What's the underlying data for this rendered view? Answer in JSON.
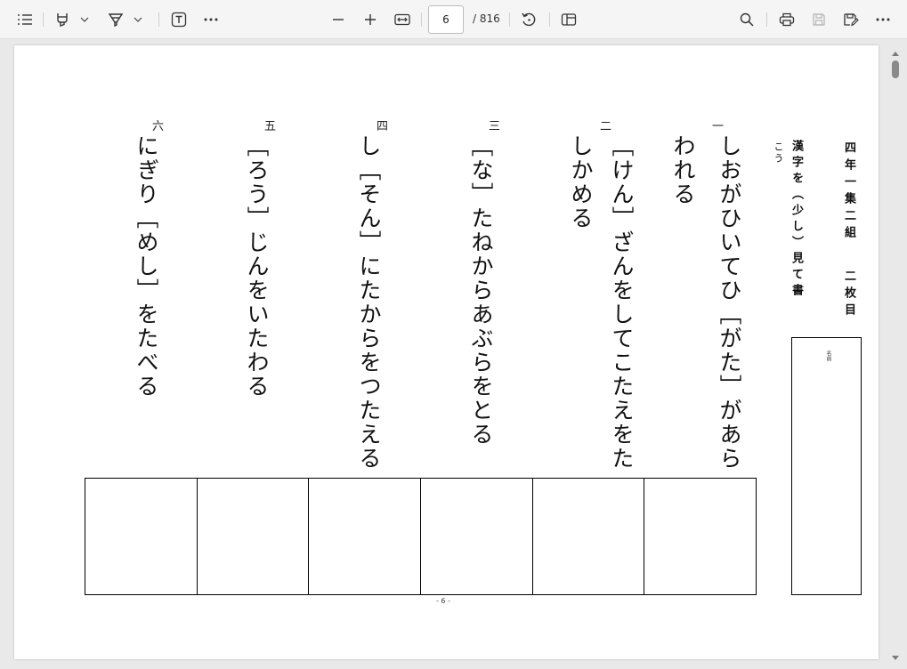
{
  "toolbar": {
    "page_number": "6",
    "page_total": "/ 816",
    "icons": [
      "contents-icon",
      "highlight-icon",
      "dropdown-icon",
      "draw-icon",
      "dropdown-icon",
      "text-icon",
      "more-icon",
      "zoom-out-icon",
      "zoom-in-icon",
      "fit-width-icon",
      "rotate-icon",
      "page-view-icon",
      "search-icon",
      "print-icon",
      "save-icon",
      "save-as-icon",
      "more-icon"
    ]
  },
  "document": {
    "header_title": "四年一集二組",
    "header_sheet": "二枚目",
    "instruction_main": "漢字を（少し）見て書",
    "instruction_cont": "こう",
    "name_label": "名前",
    "questions": [
      {
        "num": "一",
        "line1": "しおがひいてひ［がた］があら",
        "line2": "われる"
      },
      {
        "num": "二",
        "line1": "［けん］ざんをしてこたえをた",
        "line2": "しかめる"
      },
      {
        "num": "三",
        "line1": "［な］たねからあぶらをとる",
        "line2": ""
      },
      {
        "num": "四",
        "line1": "し［そん］にたからをつたえる",
        "line2": ""
      },
      {
        "num": "五",
        "line1": "［ろう］じんをいたわる",
        "line2": ""
      },
      {
        "num": "六",
        "line1": "にぎり［めし］をたべる",
        "line2": ""
      }
    ],
    "footer": "- 6 -"
  },
  "colors": {
    "toolbar_bg": "#f5f5f5",
    "canvas_bg": "#e9e9e9",
    "page_bg": "#ffffff",
    "text": "#111111"
  }
}
